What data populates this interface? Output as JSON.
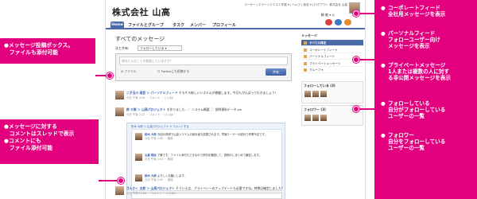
{
  "header": {
    "company_logo": "株式会社 山高",
    "top_links": "ユーザー | エラーリクエスト件数  ▾ | ヘルプ | 設定  ▾ | ログアウト  株式会社 山高",
    "user_name": "鶴 敏 ▾  ◎",
    "nav": {
      "home": "Home",
      "files_groups": "ファイルとグループ",
      "tasks": "タスク",
      "members": "メンバー",
      "profile": "プロフィール"
    }
  },
  "main": {
    "page_title": "すべてのメッセージ",
    "share_label": "次と共有:",
    "share_select": "フォローしている ▾",
    "composer_placeholder": "現在どんなことを取組していますか？",
    "attach_label": "ファイル",
    "twitter_label": "Twitterにも投稿する",
    "post_button": "共有",
    "feed": [
      {
        "who": "二子玉川 雨音 ＞ パーソナルフィード",
        "text": " そろそろ新しいシステムが稼働します。今日もがんばって行きましょう!",
        "meta": "今日 午後 3:54 ・ コメント ・ いいね!"
      },
      {
        "who": "鈴 大郎 ＞ 山高パロジェクト",
        "text": " を作りました: 📄 システム概要  📄 説明資料データ.xls",
        "meta": "今日 午後 2:22 ・ コメント ・ いいね!"
      },
      {
        "who": "さんかく 太郎 ＞ 山高パロジェクト",
        "text": " そういえば、プライバシーのアップデートも必要ですね。時期は確定しました？",
        "meta": "今日 午前 11:04 ・ コメント ・ いいね!"
      }
    ],
    "thread": {
      "header": "鈴木 大郎 ＞ 山高パロジェクト  ✎ コメントする",
      "replies": [
        {
          "who": "鈴木 大郎",
          "text": "今回の改修で山高システムの設計者も変更されます。早速ユーザーの設計で作業予定です。",
          "meta": "今日 午後 2:30 ・ 削除"
        },
        {
          "who": "山高 翔太",
          "text": "了解です。ファイル添付もできるので資料を確認して、週明けにまとめて報告します。",
          "meta": "今日 午後 2:41 ・ 削除"
        },
        {
          "who": "鈴木 大郎",
          "text": "よろしくお願いします。",
          "meta": "今日 午後 2:55 ・ 削除"
        }
      ]
    }
  },
  "sidebar": {
    "messages_heading": "メッセージ",
    "items": [
      {
        "label": "すべての発言"
      },
      {
        "label": "コーポレートフィード"
      },
      {
        "label": "パーソナルフィード"
      },
      {
        "label": "プライベートメッセージ"
      },
      {
        "label": "グループ ▾"
      }
    ],
    "following_heading": "フォローしている (3)",
    "followers_heading": "フォロワー (3)"
  },
  "callouts": {
    "left_top": "●メッセージ投稿ボックス。\n　ファイルも添付可能",
    "left_bottom": "●メッセージに対する\n　コメントはスレッドで表示\n●コメントにも\n　ファイル添付可能",
    "right": [
      {
        "bullet": "●",
        "text": "コーポレートフィード\n全社用メッセージを表示"
      },
      {
        "bullet": "●",
        "text": "パーソナルフィード\nフォローユーザー向け\nメッセージを表示"
      },
      {
        "bullet": "●",
        "text": "プライベートメッセージ\n1人または複数の人に対す\nる非公開メッセージを表示"
      },
      {
        "bullet": "●",
        "text": "フォローしている\n自分がフォローしている\nユーザーの一覧"
      },
      {
        "bullet": "●",
        "text": "フォロワー\n自分をフォローしている\nユーザーの一覧"
      }
    ]
  },
  "colors": {
    "accent": "#e3007f",
    "nav_blue": "#4b6aa8"
  }
}
